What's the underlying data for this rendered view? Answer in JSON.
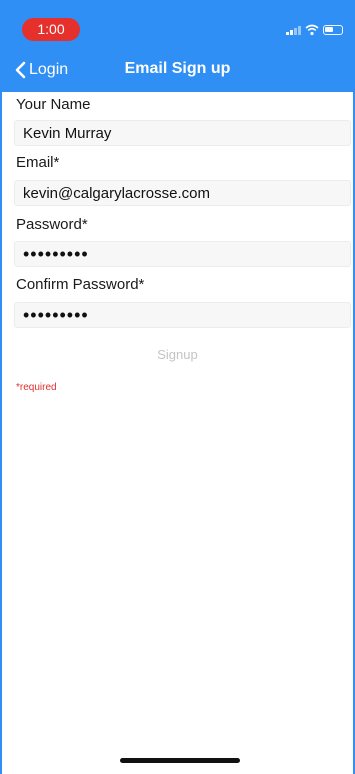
{
  "status": {
    "time": "1:00",
    "colors": {
      "pill": "#e5302b",
      "bar": "#2f8ff5"
    },
    "icons": [
      "signal-icon",
      "wifi-icon",
      "battery-icon"
    ]
  },
  "nav": {
    "back_label": "Login",
    "title": "Email Sign up",
    "back_icon": "chevron-left-icon"
  },
  "form": {
    "name_label": "Your Name",
    "name_value": "Kevin Murray",
    "email_label": "Email*",
    "email_value": "kevin@calgarylacrosse.com",
    "password_label": "Password*",
    "password_value": "•••••••••",
    "confirm_label": "Confirm Password*",
    "confirm_value": "•••••••••",
    "signup_label": "Signup",
    "required_note": "*required"
  }
}
